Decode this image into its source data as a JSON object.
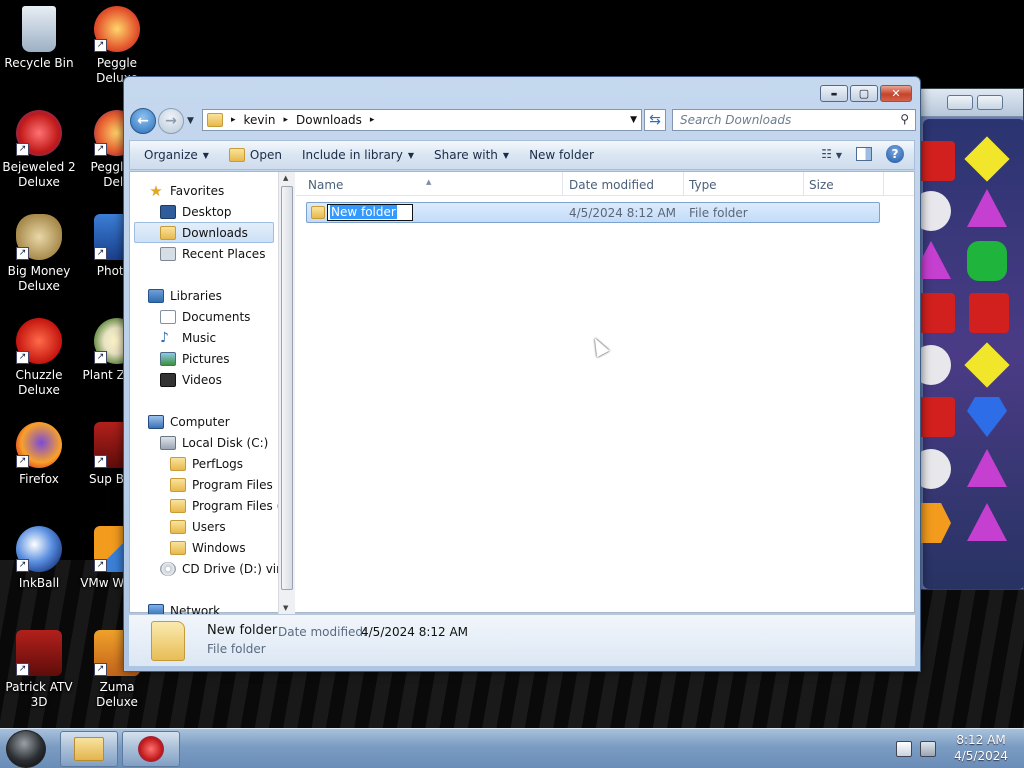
{
  "desktop": {
    "icons": [
      {
        "label": "Recycle Bin"
      },
      {
        "label": "Peggle Deluxe"
      },
      {
        "label": "Bejeweled 2 Deluxe"
      },
      {
        "label": "Peggle N Delu"
      },
      {
        "label": "Big Money Deluxe"
      },
      {
        "label": "Photos"
      },
      {
        "label": "Chuzzle Deluxe"
      },
      {
        "label": "Plant Zomb"
      },
      {
        "label": "Firefox"
      },
      {
        "label": "Sup Bazo"
      },
      {
        "label": "InkBall"
      },
      {
        "label": "VMw Workst"
      },
      {
        "label": "Patrick ATV 3D"
      },
      {
        "label": "Zuma Deluxe"
      }
    ]
  },
  "window": {
    "caption_buttons": {
      "minimize": "▬",
      "maximize": "▢",
      "close": "✕"
    },
    "address": {
      "segments": [
        "kevin",
        "Downloads"
      ],
      "separator": "▸"
    },
    "search": {
      "placeholder": "Search Downloads"
    },
    "toolbar": {
      "organize": "Organize",
      "open": "Open",
      "include": "Include in library",
      "share": "Share with",
      "new_folder": "New folder"
    },
    "nav": {
      "favorites": "Favorites",
      "desktop": "Desktop",
      "downloads": "Downloads",
      "recent": "Recent Places",
      "libraries": "Libraries",
      "documents": "Documents",
      "music": "Music",
      "pictures": "Pictures",
      "videos": "Videos",
      "computer": "Computer",
      "local_disk": "Local Disk (C:)",
      "perflogs": "PerfLogs",
      "program_files": "Program Files",
      "program_files_x86": "Program Files (",
      "users": "Users",
      "windows": "Windows",
      "cd_drive": "CD Drive (D:) virt",
      "network": "Network"
    },
    "columns": {
      "name": "Name",
      "date": "Date modified",
      "type": "Type",
      "size": "Size"
    },
    "row": {
      "name": "New folder",
      "date": "4/5/2024 8:12 AM",
      "type": "File folder"
    },
    "details": {
      "name": "New folder",
      "date_label": "Date modified:",
      "date_value": "4/5/2024 8:12 AM",
      "type": "File folder"
    }
  },
  "taskbar": {
    "time": "8:12 AM",
    "date": "4/5/2024"
  }
}
